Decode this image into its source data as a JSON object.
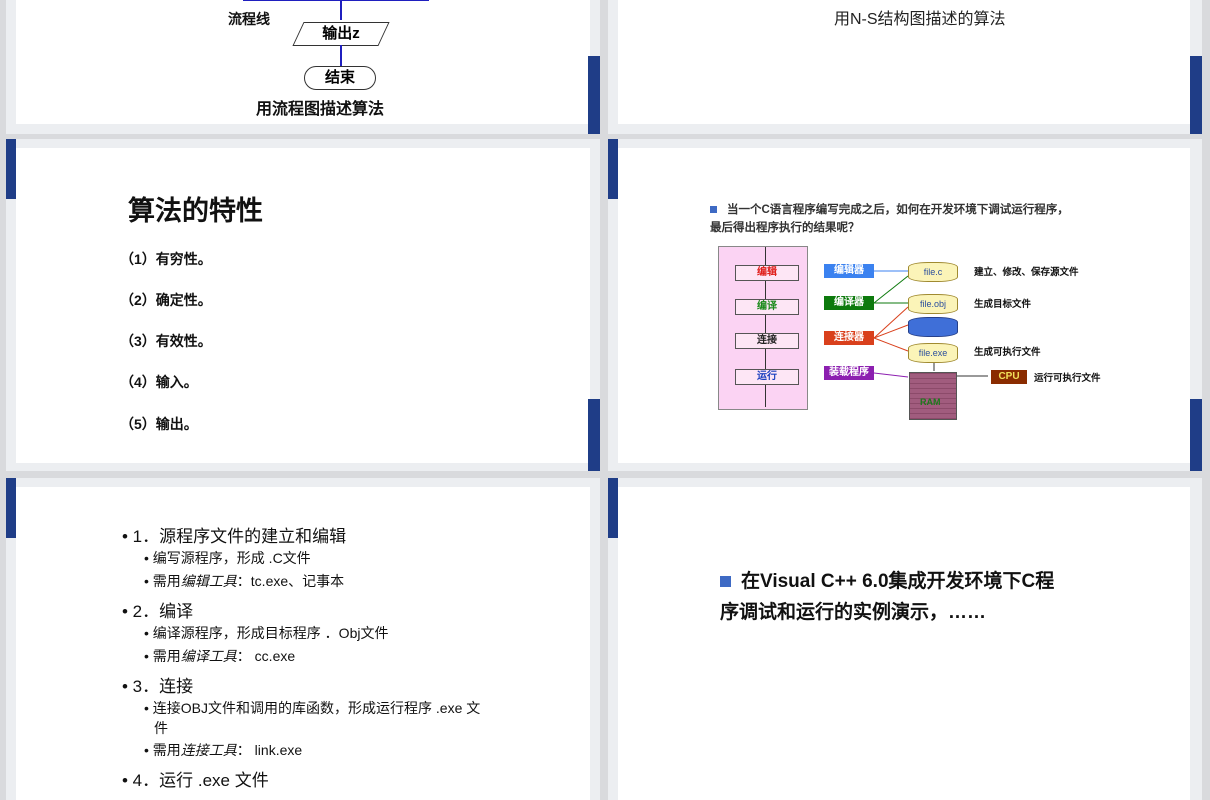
{
  "slide1": {
    "flow_label": "流程线",
    "output_box": "输出z",
    "end_box": "结束",
    "caption": "用流程图描述算法"
  },
  "slide2": {
    "caption": "用N-S结构图描述的算法"
  },
  "slide3": {
    "title": "算法的特性",
    "items": [
      "（1）有穷性。",
      "（2）确定性。",
      "（3）有效性。",
      "（4）输入。",
      "（5）输出。"
    ]
  },
  "slide4": {
    "question_line1": "当一个C语言程序编写完成之后，如何在开发环境下调试运行程序，",
    "question_line2": "最后得出程序执行的结果呢？",
    "steps": [
      "编辑",
      "编译",
      "连接",
      "运行"
    ],
    "tools": [
      {
        "label": "编辑器",
        "color": "#3b82f0"
      },
      {
        "label": "编译器",
        "color": "#0d7a0d"
      },
      {
        "label": "连接器",
        "color": "#d9401c"
      },
      {
        "label": "装载程序",
        "color": "#8c1fb0"
      }
    ],
    "files": [
      "file.c",
      "file.obj",
      "file.exe"
    ],
    "notes": [
      "建立、修改、保存源文件",
      "生成目标文件",
      "生成可执行文件",
      "运行可执行文件"
    ],
    "cpu": "CPU",
    "ram": "RAM"
  },
  "slide5": {
    "items": [
      {
        "level": 1,
        "text": "• 1．源程序文件的建立和编辑"
      },
      {
        "level": 2,
        "text": "• 编写源程序，形成 .C文件"
      },
      {
        "level": 2,
        "prefix": "• 需用",
        "em": "编辑工具",
        "suffix": "：tc.exe、记事本"
      },
      {
        "level": 1,
        "text": "• 2．编译"
      },
      {
        "level": 2,
        "text": "• 编译源程序，形成目标程序 ．Obj文件"
      },
      {
        "level": 2,
        "prefix": "• 需用",
        "em": "编译工具",
        "suffix": "： cc.exe"
      },
      {
        "level": 1,
        "text": "• 3．连接"
      },
      {
        "level": 2,
        "text": "• 连接OBJ文件和调用的库函数，形成运行程序 .exe 文"
      },
      {
        "level": 2,
        "text": "件"
      },
      {
        "level": 2,
        "prefix": "• 需用",
        "em": "连接工具",
        "suffix": "： link.exe"
      },
      {
        "level": 1,
        "text": "• 4．运行 .exe 文件"
      }
    ]
  },
  "slide6": {
    "line1": "在Visual C++ 6.0集成开发环境下C程",
    "line2": "序调试和运行的实例演示，……"
  }
}
